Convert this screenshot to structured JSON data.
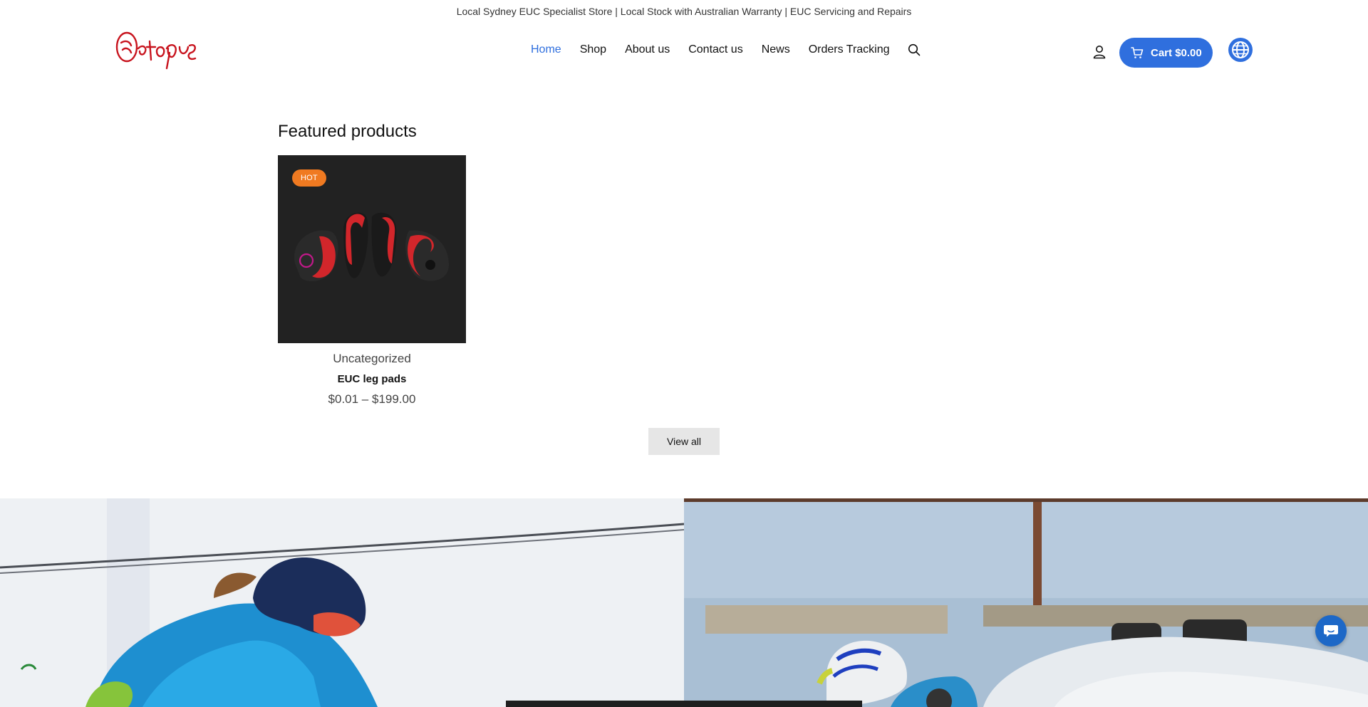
{
  "announcement": {
    "text": "Local Sydney EUC Specialist Store | Local Stock with Australian Warranty | EUC Servicing and Repairs"
  },
  "brand": {
    "logo_text": "Octopus",
    "logo_color": "#c8141e"
  },
  "nav": {
    "items": [
      {
        "label": "Home",
        "active": true
      },
      {
        "label": "Shop",
        "active": false
      },
      {
        "label": "About us",
        "active": false
      },
      {
        "label": "Contact us",
        "active": false
      },
      {
        "label": "News",
        "active": false
      },
      {
        "label": "Orders Tracking",
        "active": false
      }
    ],
    "search_icon": "search-icon"
  },
  "header_actions": {
    "account_icon": "user-icon",
    "cart_label": "Cart",
    "cart_total": "$0.00",
    "cart_icon": "cart-icon",
    "globe_icon": "globe-icon"
  },
  "featured": {
    "title": "Featured products",
    "products": [
      {
        "badge": "HOT",
        "category": "Uncategorized",
        "name": "EUC leg pads",
        "price": "$0.01 – $199.00"
      }
    ],
    "view_all_label": "View all"
  },
  "colors": {
    "accent": "#2f6fde",
    "badge": "#f07a21",
    "chat": "#1d68c7"
  },
  "chat": {
    "icon": "chat-bubble-icon"
  }
}
